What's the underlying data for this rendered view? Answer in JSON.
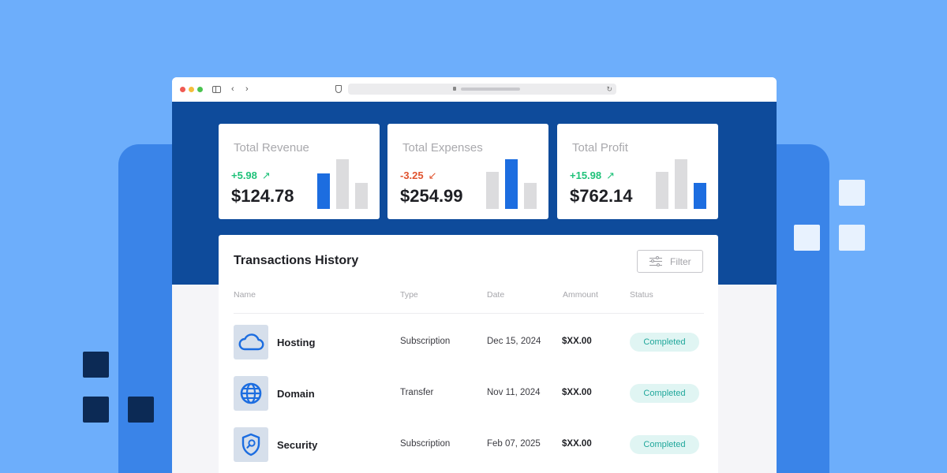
{
  "colors": {
    "background": "#6daefb",
    "header_band": "#0e4b9b",
    "accent_blue": "#1c6de0",
    "positive": "#20c27a",
    "negative": "#e0532e",
    "badge_bg": "#e0f5f3",
    "badge_text": "#20a79b"
  },
  "browser": {
    "nav_back_glyph": "‹",
    "nav_forward_glyph": "›",
    "reload_glyph": "↻"
  },
  "cards": [
    {
      "title": "Total Revenue",
      "change": "+5.98",
      "trend": "up",
      "arrow": "↗",
      "value": "$124.78",
      "highlight_bar": 0,
      "bar_levels": [
        0.72,
        1.0,
        0.52
      ]
    },
    {
      "title": "Total Expenses",
      "change": "-3.25",
      "trend": "down",
      "arrow": "↙",
      "value": "$254.99",
      "highlight_bar": 1,
      "bar_levels": [
        0.75,
        1.0,
        0.52
      ]
    },
    {
      "title": "Total Profit",
      "change": "+15.98",
      "trend": "up",
      "arrow": "↗",
      "value": "$762.14",
      "highlight_bar": 2,
      "bar_levels": [
        0.75,
        1.0,
        0.52
      ]
    }
  ],
  "transactions": {
    "title": "Transactions History",
    "filter_label": "Filter",
    "columns": [
      "Name",
      "Type",
      "Date",
      "Ammount",
      "Status"
    ],
    "rows": [
      {
        "icon": "cloud-icon",
        "name": "Hosting",
        "type": "Subscription",
        "date": "Dec 15, 2024",
        "amount": "$XX.00",
        "status": "Completed"
      },
      {
        "icon": "globe-icon",
        "name": "Domain",
        "type": "Transfer",
        "date": "Nov 11, 2024",
        "amount": "$XX.00",
        "status": "Completed"
      },
      {
        "icon": "shield-search-icon",
        "name": "Security",
        "type": "Subscription",
        "date": "Feb 07, 2025",
        "amount": "$XX.00",
        "status": "Completed"
      }
    ]
  }
}
